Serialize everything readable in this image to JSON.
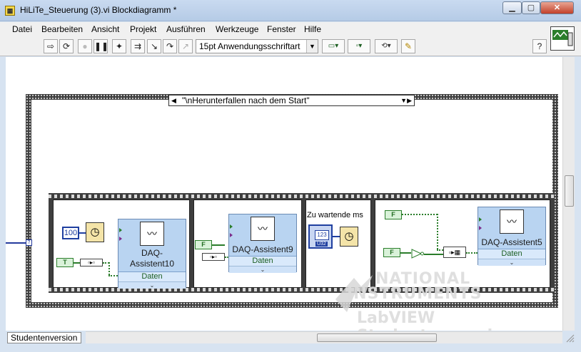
{
  "window": {
    "title": "HiLiTe_Steuerung (3).vi Blockdiagramm *",
    "min": "▁",
    "max": "▢",
    "close": "✕"
  },
  "menu": [
    "Datei",
    "Bearbeiten",
    "Ansicht",
    "Projekt",
    "Ausführen",
    "Werkzeuge",
    "Fenster",
    "Hilfe"
  ],
  "toolbar": {
    "font": "15pt Anwendungsschriftart",
    "help": "?"
  },
  "case": {
    "selector": "\"\\nHerunterfallen nach dem Start\""
  },
  "frame1": {
    "const_value": "100",
    "bool_const": "T",
    "daq_label": "DAQ-\nAssistent10",
    "daq_output": "Daten"
  },
  "frame2": {
    "bool_const": "F",
    "daq_label": "DAQ-Assistent9",
    "daq_output": "Daten"
  },
  "frame3": {
    "control_label": "Zu wartende ms",
    "numeric_display": "123",
    "numeric_type": "U32"
  },
  "frame4": {
    "bool_const_1": "F",
    "bool_const_2": "F",
    "daq_label": "DAQ-Assistent5",
    "daq_output": "Daten"
  },
  "status": "Studentenversion",
  "watermark": {
    "line1": "NATIONAL",
    "line2": "INSTRUMENTS",
    "line3": "LabVIEW Studentenversion"
  }
}
